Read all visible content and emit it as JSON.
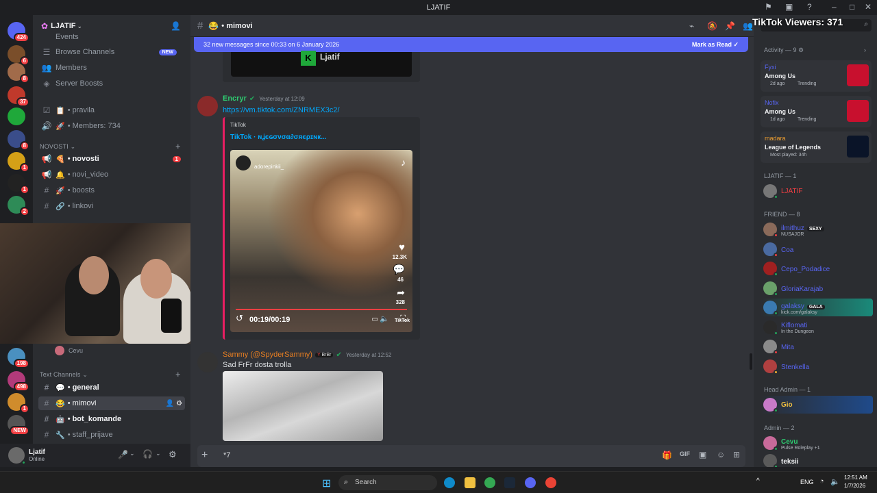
{
  "window": {
    "title": "LJATIF"
  },
  "overlay": {
    "tiktok_viewers": "TikTok Viewers: 371"
  },
  "servers": [
    {
      "badge": "424",
      "color": "#5865f2"
    },
    {
      "badge": "6",
      "color": "#7a4e2a"
    },
    {
      "badge": "8",
      "color": "#a16b4a"
    },
    {
      "badge": "37",
      "color": "#c0392b"
    },
    {
      "badge": "",
      "color": "#1fa83a"
    },
    {
      "badge": "8",
      "color": "#3a4d8a"
    },
    {
      "badge": "1",
      "color": "#d4a017"
    },
    {
      "badge": "1",
      "color": "#222"
    },
    {
      "badge": "2",
      "color": "#2e8b57"
    },
    {
      "badge": "198",
      "color": "#4a90c0"
    },
    {
      "badge": "498",
      "color": "#b23a7a"
    },
    {
      "badge": "1",
      "color": "#d08c2c"
    },
    {
      "badge": "NEW",
      "color": "#555"
    }
  ],
  "guild": {
    "name": "LJATIF"
  },
  "channels": {
    "events": "Events",
    "browse": "Browse Channels",
    "browse_badge": "NEW",
    "members": "Members",
    "boosts": "Server Boosts",
    "pravila": "pravila",
    "member_count": "Members: 734",
    "cat_novosti": "NOVOSTI",
    "novosti": "novosti",
    "novosti_badge": "1",
    "novi_video": "novi_video",
    "boosts_ch": "boosts",
    "linkovi": "linkovi",
    "voice_user": "Cevu",
    "cat_text": "Text Channels",
    "general": "general",
    "mimovi": "mimovi",
    "bot_komande": "bot_komande",
    "staff_prijave": "staff_prijave"
  },
  "user": {
    "name": "Ljatif",
    "status": "Online"
  },
  "chat": {
    "channel": "mimovi",
    "banner": "32 new messages since 00:33 on 6 January 2026",
    "mark_read": "Mark as Read",
    "embed_top_label": "Ljatif",
    "m1": {
      "author": "Encryr",
      "time": "Yesterday at 12:09",
      "link": "https://vm.tiktok.com/ZNRMEX3c2/",
      "provider": "TikTok",
      "title": "TikTok · ɴʝєɢσνσα∂σяєρɪɴк...",
      "video_user": "adorepinkii_",
      "likes": "12.3K",
      "comments": "46",
      "shares": "328",
      "time_display": "00:19/00:19",
      "watermark": "TikTok"
    },
    "m2": {
      "author": "Sammy (@SpyderSammy)",
      "tag": "BrBr",
      "time": "Yesterday at 12:52",
      "text": "Sad FrFr dosta trolla"
    },
    "composer_text": "*7"
  },
  "members": {
    "activity_head": "Activity — 9",
    "act": [
      {
        "name": "Fyxi",
        "game": "Among Us",
        "meta": "2d ago",
        "trend": "Trending"
      },
      {
        "name": "Nofix",
        "game": "Among Us",
        "meta": "1d ago",
        "trend": "Trending"
      },
      {
        "name": "madara",
        "game": "League of Legends",
        "meta": "Most played: 34h"
      }
    ],
    "sec_ljatif": "LJATIF — 1",
    "ljatif": "LJATIF",
    "sec_friend": "FRIEND — 8",
    "friends": [
      {
        "name": "ilmithuz",
        "tag": "SEXY",
        "sub": "NUSAJOR",
        "color": "#5865f2",
        "av": "#8a6a5a",
        "st": "#f23f43"
      },
      {
        "name": "Coa",
        "tag": "",
        "sub": "",
        "color": "#5865f2",
        "av": "#4a6aa0",
        "st": "#f23f43"
      },
      {
        "name": "Cepo_Podadice",
        "tag": "",
        "sub": "",
        "color": "#5865f2",
        "av": "#a02020",
        "st": "#23a55a"
      },
      {
        "name": "GloriaKarajab",
        "tag": "",
        "sub": "",
        "color": "#5865f2",
        "av": "#6aa06a",
        "st": "#23a55a"
      },
      {
        "name": "galaksy",
        "tag": "GALA",
        "sub": "kick.com/galaksy",
        "color": "#5865f2",
        "av": "#3a7ab0",
        "st": "#23a55a"
      },
      {
        "name": "Kiflomati",
        "tag": "",
        "sub": "In the Dungeon",
        "color": "#5865f2",
        "av": "#2a2a2a",
        "st": "#23a55a"
      },
      {
        "name": "Mita",
        "tag": "",
        "sub": "",
        "color": "#5865f2",
        "av": "#8a8a8a",
        "st": "#f23f43"
      },
      {
        "name": "Stenkella",
        "tag": "",
        "sub": "",
        "color": "#5865f2",
        "av": "#b04040",
        "st": "#f0b232"
      }
    ],
    "sec_head": "Head Admin — 1",
    "head_admin": "Gio",
    "sec_admin": "Admin — 2",
    "admins": [
      {
        "name": "Cevu",
        "sub": "Pulse Roleplay +1"
      },
      {
        "name": "teksii",
        "sub": ""
      }
    ]
  },
  "taskbar": {
    "search": "Search",
    "lang": "ENG",
    "time": "12:51 AM",
    "date": "1/7/2026"
  }
}
